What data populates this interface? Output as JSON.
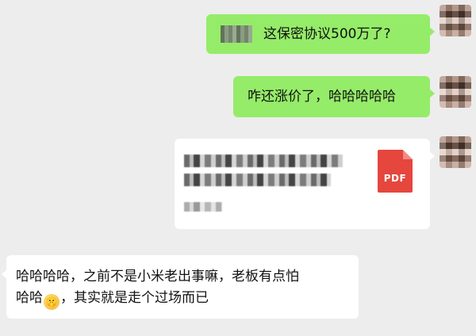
{
  "messages": [
    {
      "side": "right",
      "type": "text",
      "redacted_prefix": true,
      "text": "这保密协议500万了?"
    },
    {
      "side": "right",
      "type": "text",
      "text": "咋还涨价了，哈哈哈哈哈"
    },
    {
      "side": "right",
      "type": "file",
      "file_icon_label": "PDF",
      "icon": "pdf-file-icon"
    },
    {
      "side": "left",
      "type": "text",
      "text_line1": "哈哈哈哈，之前不是小米老出事嘛，老板有点怕",
      "text_line2_a": "哈哈",
      "emoji": "shushing-face-emoji",
      "emoji_glyph": "🤫",
      "text_line2_b": "，其实就是走个过场而已"
    }
  ],
  "colors": {
    "background": "#ededed",
    "sent_bubble": "#95ec69",
    "received_bubble": "#ffffff",
    "pdf_icon": "#e5463d"
  }
}
